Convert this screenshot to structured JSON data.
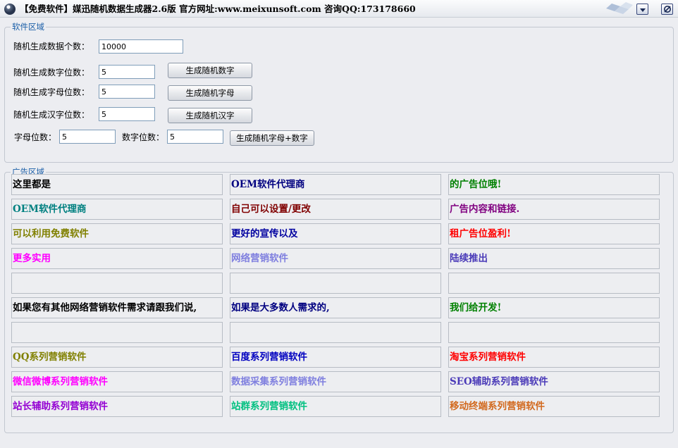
{
  "window": {
    "title": "【免费软件】媒迅随机数据生成器2.6版   官方网址:www.meixunsoft.com 咨询QQ:173178660"
  },
  "software_group": {
    "legend": "软件区域",
    "count_label": "随机生成数据个数：",
    "count_value": "10000",
    "digit_label": "随机生成数字位数：",
    "digit_value": "5",
    "digit_button": "生成随机数字",
    "letter_label": "随机生成字母位数：",
    "letter_value": "5",
    "letter_button": "生成随机字母",
    "hanzi_label": "随机生成汉字位数：",
    "hanzi_value": "5",
    "hanzi_button": "生成随机汉字",
    "mix_letter_label": "字母位数：",
    "mix_letter_value": "5",
    "mix_digit_label": "数字位数：",
    "mix_digit_value": "5",
    "mix_button": "生成随机字母+数字"
  },
  "ad_group": {
    "legend": "广告区域",
    "rows": [
      [
        {
          "text": "这里都是",
          "color": "#000000"
        },
        {
          "text": "OEM软件代理商",
          "color": "#000080"
        },
        {
          "text": "的广告位哦!",
          "color": "#008000"
        }
      ],
      [
        {
          "text": "OEM软件代理商",
          "color": "#008080"
        },
        {
          "text": "自己可以设置/更改",
          "color": "#800000"
        },
        {
          "text": "广告内容和链接.",
          "color": "#800080"
        }
      ],
      [
        {
          "text": "可以利用免费软件",
          "color": "#808000"
        },
        {
          "text": "更好的宣传以及",
          "color": "#0000a0"
        },
        {
          "text": "租广告位盈利!",
          "color": "#ff0000"
        }
      ],
      [
        {
          "text": "更多实用",
          "color": "#ff00ff"
        },
        {
          "text": "网络营销软件",
          "color": "#7f7fdf"
        },
        {
          "text": "陆续推出",
          "color": "#4a3ab8"
        }
      ],
      [
        {
          "text": "",
          "color": "#000000"
        },
        {
          "text": "",
          "color": "#000000"
        },
        {
          "text": "",
          "color": "#000000"
        }
      ],
      [
        {
          "text": "如果您有其他网络营销软件需求请跟我们说,",
          "color": "#000000"
        },
        {
          "text": "如果是大多数人需求的,",
          "color": "#000080"
        },
        {
          "text": "我们给开发!",
          "color": "#008000"
        }
      ],
      [
        {
          "text": "",
          "color": "#000000"
        },
        {
          "text": "",
          "color": "#000000"
        },
        {
          "text": "",
          "color": "#000000"
        }
      ],
      [
        {
          "text": "QQ系列营销软件",
          "color": "#808000"
        },
        {
          "text": "百度系列营销软件",
          "color": "#0000c0"
        },
        {
          "text": "淘宝系列营销软件",
          "color": "#ff0000"
        }
      ],
      [
        {
          "text": "微信微博系列营销软件",
          "color": "#ff00ff"
        },
        {
          "text": "数据采集系列营销软件",
          "color": "#7f7fdf"
        },
        {
          "text": "SEO辅助系列营销软件",
          "color": "#4a3ab8"
        }
      ],
      [
        {
          "text": "站长辅助系列营销软件",
          "color": "#9400d3"
        },
        {
          "text": "站群系列营销软件",
          "color": "#00c080"
        },
        {
          "text": "移动终端系列营销软件",
          "color": "#d2691e"
        }
      ]
    ]
  }
}
